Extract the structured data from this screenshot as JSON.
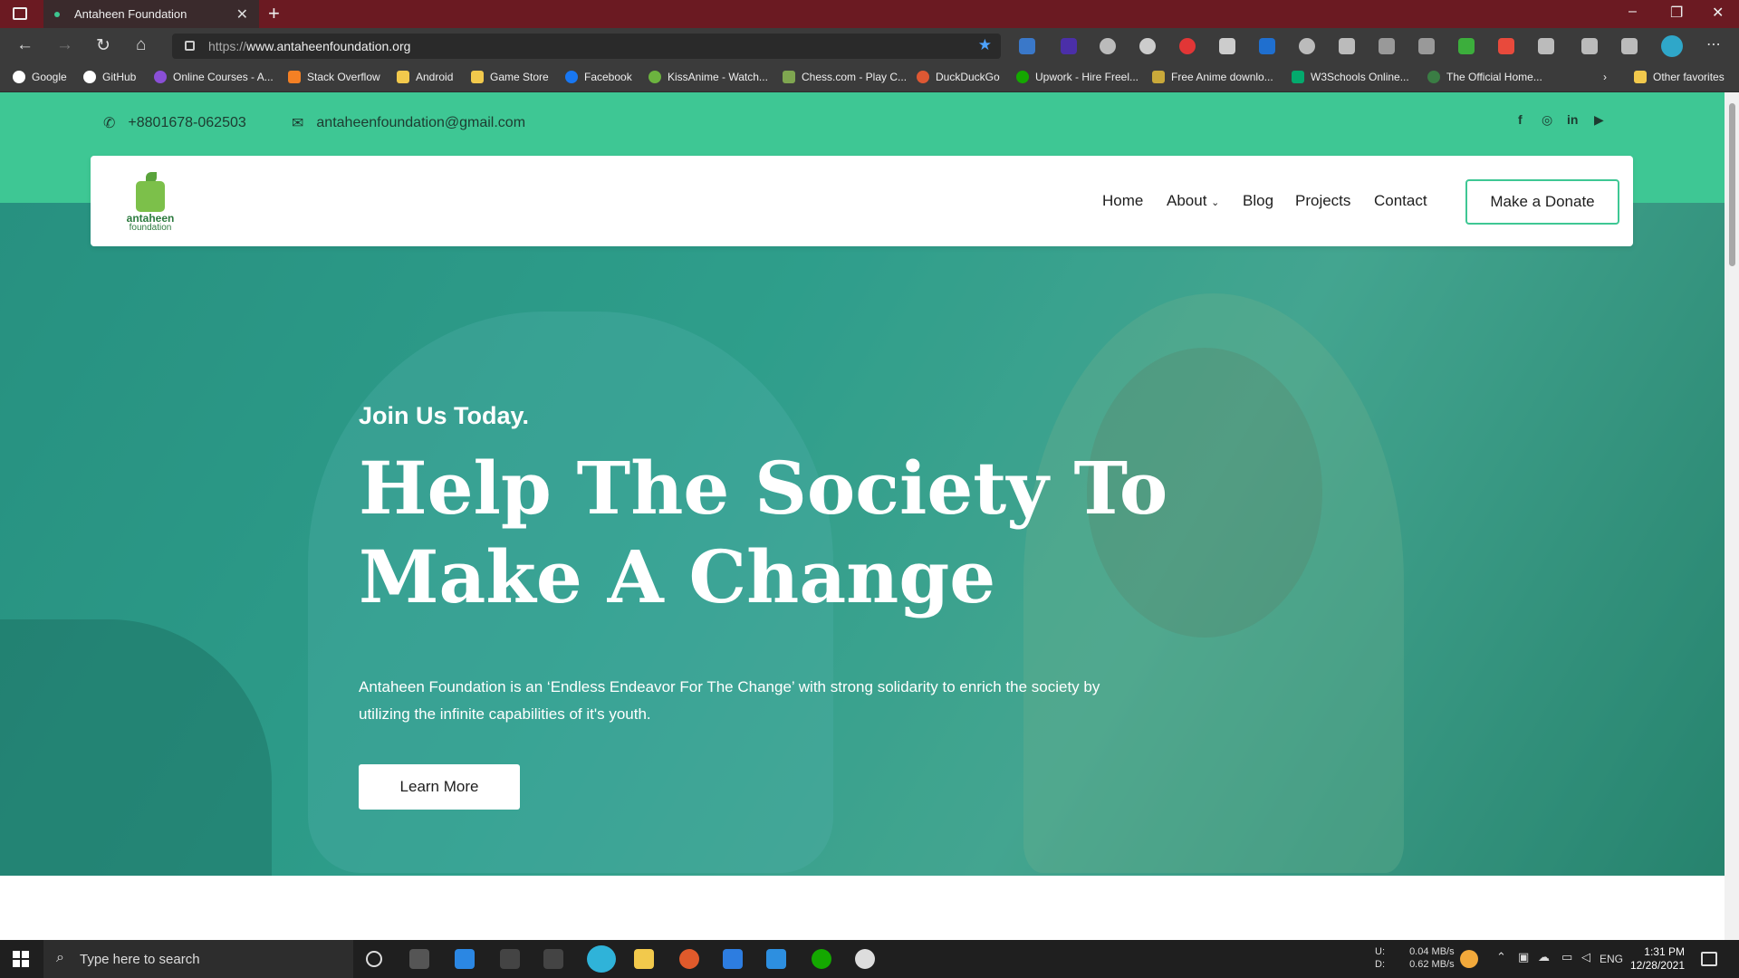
{
  "browser": {
    "tab_title": "Antaheen Foundation",
    "url_scheme": "https://",
    "url_host": "www.antaheenfoundation.org",
    "bookmarks": [
      "Google",
      "GitHub",
      "Online Courses - A...",
      "Stack Overflow",
      "Android",
      "Game Store",
      "Facebook",
      "KissAnime - Watch...",
      "Chess.com - Play C...",
      "DuckDuckGo",
      "Upwork - Hire Freel...",
      "Free Anime downlo...",
      "W3Schools Online...",
      "The Official Home..."
    ],
    "other_favorites": "Other favorites"
  },
  "topbar": {
    "phone": "+8801678-062503",
    "email": "antaheenfoundation@gmail.com",
    "social": [
      "facebook-icon",
      "instagram-icon",
      "linkedin-icon",
      "youtube-icon"
    ]
  },
  "nav": {
    "logo_line1": "antaheen",
    "logo_line2": "foundation",
    "items": [
      "Home",
      "About",
      "Blog",
      "Projects",
      "Contact"
    ],
    "donate": "Make a Donate"
  },
  "hero": {
    "kicker": "Join Us Today.",
    "headline_line1": "Help The Society To",
    "headline_line2": "Make A Change",
    "lead": "Antaheen Foundation is an ‘Endless Endeavor For The Change’ with strong solidarity to enrich the society by utilizing the infinite capabilities of it's youth.",
    "cta": "Learn More"
  },
  "taskbar": {
    "search_placeholder": "Type here to search",
    "net_up_label": "U:",
    "net_up": "0.04 MB/s",
    "net_down_label": "D:",
    "net_down": "0.62 MB/s",
    "lang": "ENG",
    "time": "1:31 PM",
    "date": "12/28/2021"
  },
  "colors": {
    "accent": "#3ec794",
    "tabbar": "#6b1a22"
  }
}
